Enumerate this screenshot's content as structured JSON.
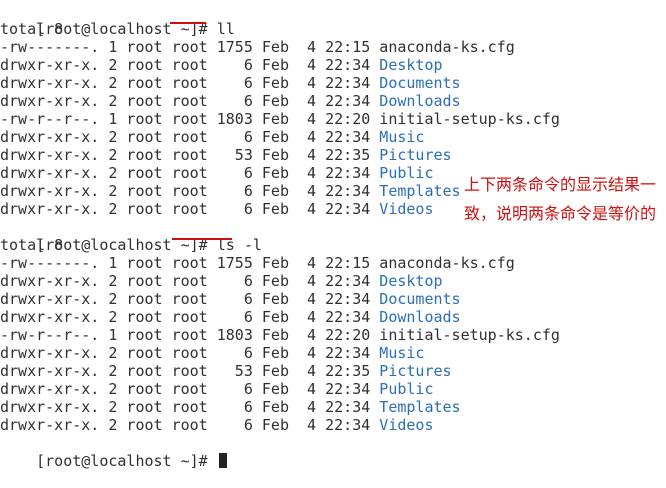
{
  "block1": {
    "prompt": "[root@localhost ~]# ",
    "command": "ll",
    "total": "total 8",
    "rows": [
      {
        "meta": "-rw-------. 1 root root 1755 Feb  4 22:15 ",
        "name": "anaconda-ks.cfg",
        "dir": false
      },
      {
        "meta": "drwxr-xr-x. 2 root root    6 Feb  4 22:34 ",
        "name": "Desktop",
        "dir": true
      },
      {
        "meta": "drwxr-xr-x. 2 root root    6 Feb  4 22:34 ",
        "name": "Documents",
        "dir": true
      },
      {
        "meta": "drwxr-xr-x. 2 root root    6 Feb  4 22:34 ",
        "name": "Downloads",
        "dir": true
      },
      {
        "meta": "-rw-r--r--. 1 root root 1803 Feb  4 22:20 ",
        "name": "initial-setup-ks.cfg",
        "dir": false
      },
      {
        "meta": "drwxr-xr-x. 2 root root    6 Feb  4 22:34 ",
        "name": "Music",
        "dir": true
      },
      {
        "meta": "drwxr-xr-x. 2 root root   53 Feb  4 22:35 ",
        "name": "Pictures",
        "dir": true
      },
      {
        "meta": "drwxr-xr-x. 2 root root    6 Feb  4 22:34 ",
        "name": "Public",
        "dir": true
      },
      {
        "meta": "drwxr-xr-x. 2 root root    6 Feb  4 22:34 ",
        "name": "Templates",
        "dir": true
      },
      {
        "meta": "drwxr-xr-x. 2 root root    6 Feb  4 22:34 ",
        "name": "Videos",
        "dir": true
      }
    ]
  },
  "block2": {
    "prompt": "[root@localhost ~]# ",
    "command": "ls -l",
    "total": "total 8",
    "rows": [
      {
        "meta": "-rw-------. 1 root root 1755 Feb  4 22:15 ",
        "name": "anaconda-ks.cfg",
        "dir": false
      },
      {
        "meta": "drwxr-xr-x. 2 root root    6 Feb  4 22:34 ",
        "name": "Desktop",
        "dir": true
      },
      {
        "meta": "drwxr-xr-x. 2 root root    6 Feb  4 22:34 ",
        "name": "Documents",
        "dir": true
      },
      {
        "meta": "drwxr-xr-x. 2 root root    6 Feb  4 22:34 ",
        "name": "Downloads",
        "dir": true
      },
      {
        "meta": "-rw-r--r--. 1 root root 1803 Feb  4 22:20 ",
        "name": "initial-setup-ks.cfg",
        "dir": false
      },
      {
        "meta": "drwxr-xr-x. 2 root root    6 Feb  4 22:34 ",
        "name": "Music",
        "dir": true
      },
      {
        "meta": "drwxr-xr-x. 2 root root   53 Feb  4 22:35 ",
        "name": "Pictures",
        "dir": true
      },
      {
        "meta": "drwxr-xr-x. 2 root root    6 Feb  4 22:34 ",
        "name": "Public",
        "dir": true
      },
      {
        "meta": "drwxr-xr-x. 2 root root    6 Feb  4 22:34 ",
        "name": "Templates",
        "dir": true
      },
      {
        "meta": "drwxr-xr-x. 2 root root    6 Feb  4 22:34 ",
        "name": "Videos",
        "dir": true
      }
    ]
  },
  "final_prompt": "[root@localhost ~]# ",
  "annotation": "上下两条命令的显示结果一致，说明两条命令是等价的",
  "colors": {
    "directory": "#2c6fb5",
    "annotation": "#d01010",
    "text": "#303030"
  }
}
